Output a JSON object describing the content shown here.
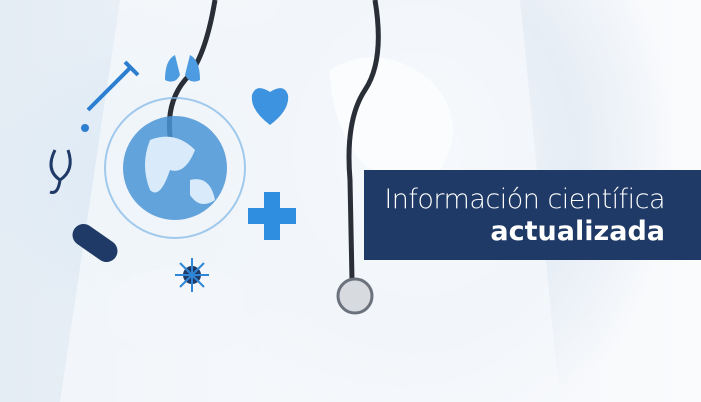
{
  "banner": {
    "line1": "Información científica",
    "line2": "actualizada"
  },
  "colors": {
    "banner_bg": "#1f3a66",
    "icon_blue": "#2f86d6",
    "icon_dark": "#1f3a66"
  }
}
